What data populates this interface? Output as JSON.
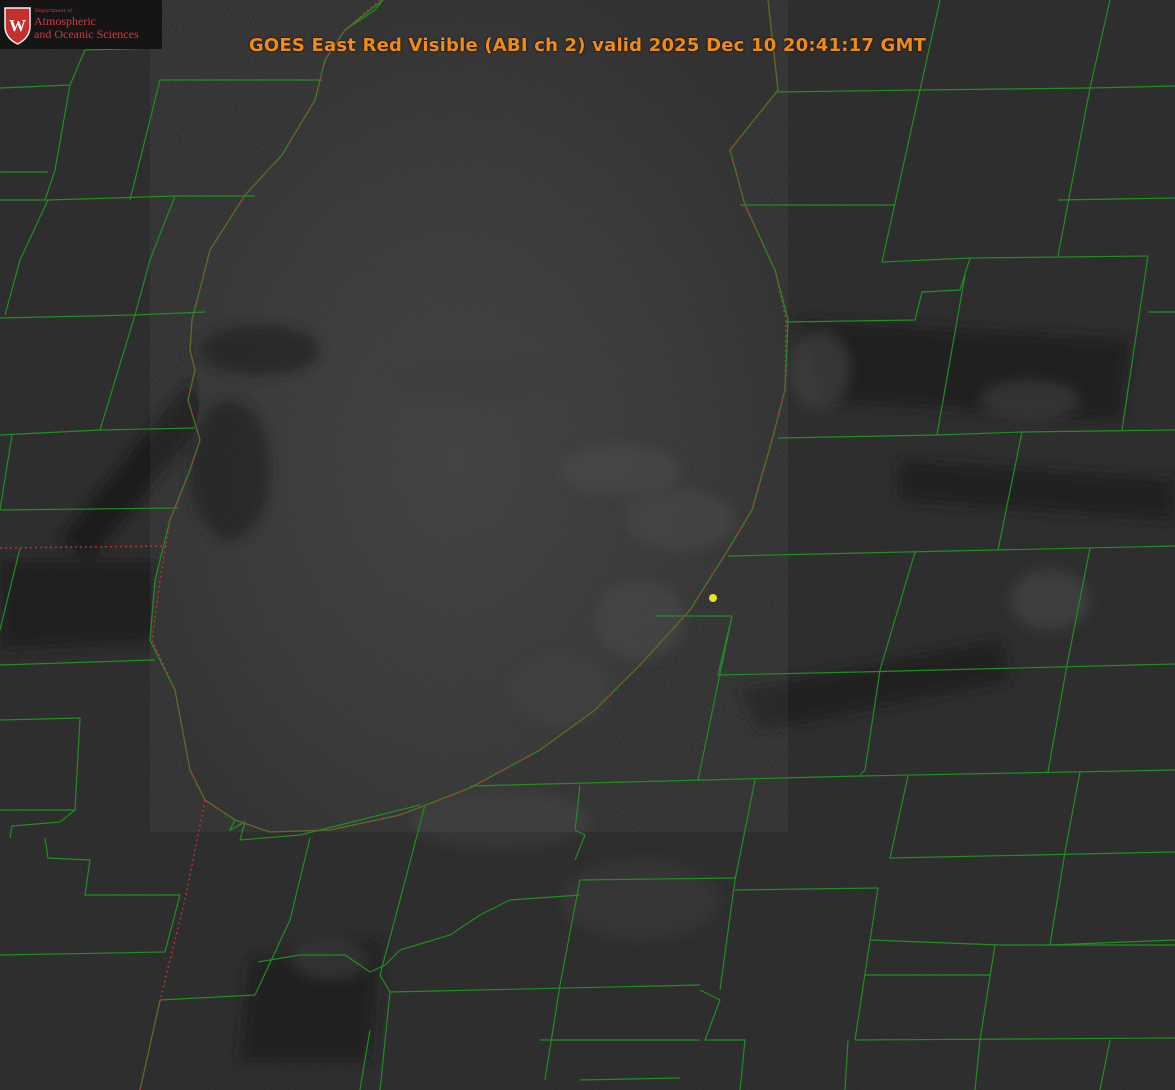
{
  "title": "GOES East Red Visible (ABI ch 2) valid 2025 Dec 10 20:41:17 GMT",
  "logo": {
    "letter": "W",
    "department": "Department of",
    "line1": "Atmospheric",
    "line2": "and Oceanic Sciences"
  },
  "colors": {
    "title": "#f08a18",
    "county_lines": "#1f8f1f",
    "state_border": "#c03030",
    "marker": "#e6e61e",
    "logo_red": "#c5302f"
  },
  "layers": [
    "visible-satellite-imagery",
    "lake-michigan",
    "county-boundaries",
    "state-boundaries",
    "location-marker"
  ]
}
